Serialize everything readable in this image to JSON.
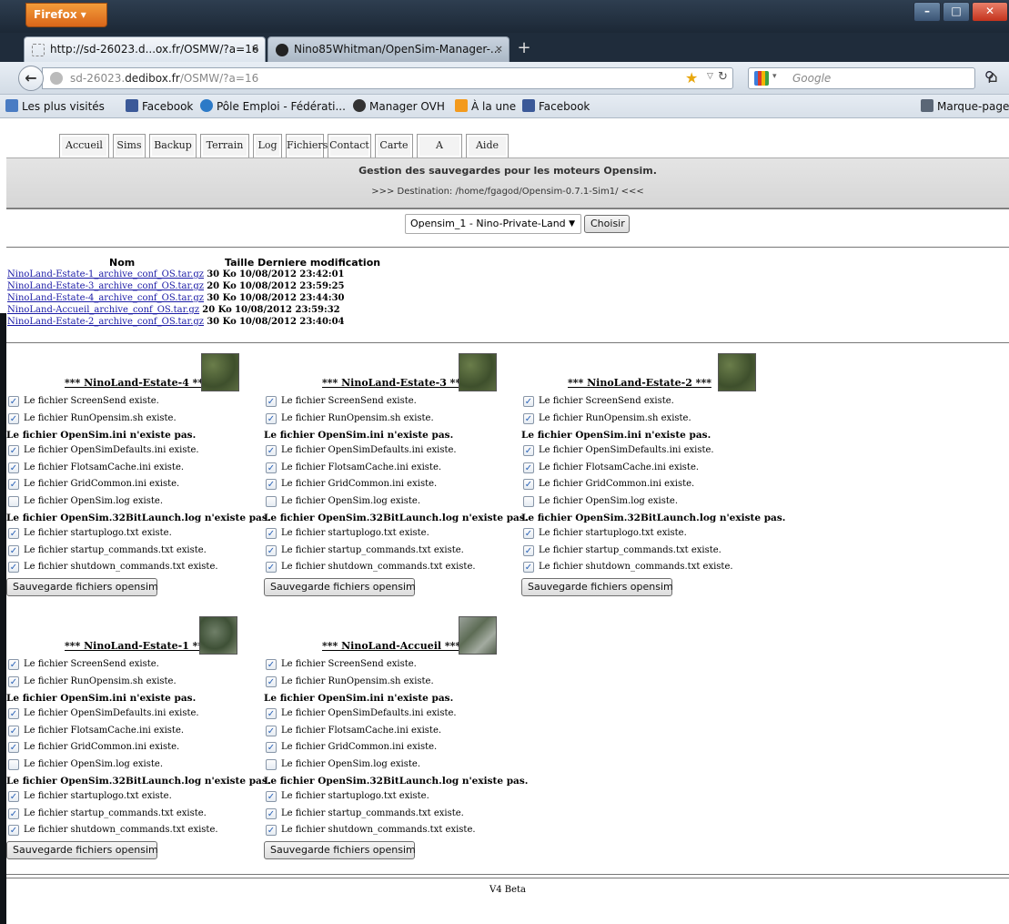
{
  "browser": {
    "menu_label": "Firefox",
    "tabs": [
      {
        "title": "http://sd-26023.d...ox.fr/OSMW/?a=16",
        "close": "×"
      },
      {
        "title": "Nino85Whitman/OpenSim-Manager-...",
        "close": "×"
      }
    ],
    "new_tab": "+",
    "url_grey": "sd-26023.",
    "url_domain": "dedibox.fr",
    "url_path": "/OSMW/?a=16",
    "search_placeholder": "Google",
    "bookmarks": [
      "Les plus visités",
      "Facebook",
      "Pôle Emploi - Fédérati...",
      "Manager OVH",
      "À la une",
      "Facebook"
    ],
    "bookmarks_menu": "Marque-pages"
  },
  "nav_tabs": [
    "Accueil",
    "Sims",
    "Backup",
    "Terrain",
    "Log",
    "Fichiers",
    "Contact",
    "Carte",
    "A Propos",
    "Aide"
  ],
  "header": {
    "title": "Gestion des sauvegardes pour les moteurs Opensim.",
    "destination": ">>> Destination: /home/fgagod/Opensim-0.7.1-Sim1/ <<<"
  },
  "selector": {
    "selected": "Opensim_1 - Nino-Private-Land",
    "button": "Choisir"
  },
  "files": {
    "columns": [
      "Nom",
      "Taille Derniere modification"
    ],
    "rows": [
      {
        "name": "NinoLand-Estate-1_archive_conf_OS.tar.gz",
        "size": "30 Ko",
        "date": "10/08/2012 23:42:01"
      },
      {
        "name": "NinoLand-Estate-3_archive_conf_OS.tar.gz",
        "size": "20 Ko",
        "date": "10/08/2012 23:59:25"
      },
      {
        "name": "NinoLand-Estate-4_archive_conf_OS.tar.gz",
        "size": "30 Ko",
        "date": "10/08/2012 23:44:30"
      },
      {
        "name": "NinoLand-Accueil_archive_conf_OS.tar.gz",
        "size": "20 Ko",
        "date": "10/08/2012 23:59:32"
      },
      {
        "name": "NinoLand-Estate-2_archive_conf_OS.tar.gz",
        "size": "30 Ko",
        "date": "10/08/2012 23:40:04"
      }
    ]
  },
  "sim_lines": [
    {
      "text": "Le fichier ScreenSend existe.",
      "checked": true
    },
    {
      "text": "Le fichier RunOpensim.sh existe.",
      "checked": true
    },
    {
      "text": "Le fichier OpenSim.ini n'existe pas.",
      "bold": true
    },
    {
      "text": "Le fichier OpenSimDefaults.ini existe.",
      "checked": true
    },
    {
      "text": "Le fichier FlotsamCache.ini existe.",
      "checked": true
    },
    {
      "text": "Le fichier GridCommon.ini existe.",
      "checked": true
    },
    {
      "text": "Le fichier OpenSim.log existe.",
      "checked": false
    },
    {
      "text": "Le fichier OpenSim.32BitLaunch.log n'existe pas.",
      "bold": true
    },
    {
      "text": "Le fichier startuplogo.txt existe.",
      "checked": true
    },
    {
      "text": "Le fichier startup_commands.txt existe.",
      "checked": true
    },
    {
      "text": "Le fichier shutdown_commands.txt existe.",
      "checked": true
    }
  ],
  "sims": [
    {
      "title": "*** NinoLand-Estate-4 ***",
      "thumb": "t1"
    },
    {
      "title": "*** NinoLand-Estate-3 ***",
      "thumb": "t1"
    },
    {
      "title": "*** NinoLand-Estate-2 ***",
      "thumb": "t1"
    },
    {
      "title": "*** NinoLand-Estate-1 ***",
      "thumb": "t2"
    },
    {
      "title": "*** NinoLand-Accueil ***",
      "thumb": "t3"
    }
  ],
  "save_button": "Sauvegarde fichiers opensim",
  "footer": "V4 Beta"
}
